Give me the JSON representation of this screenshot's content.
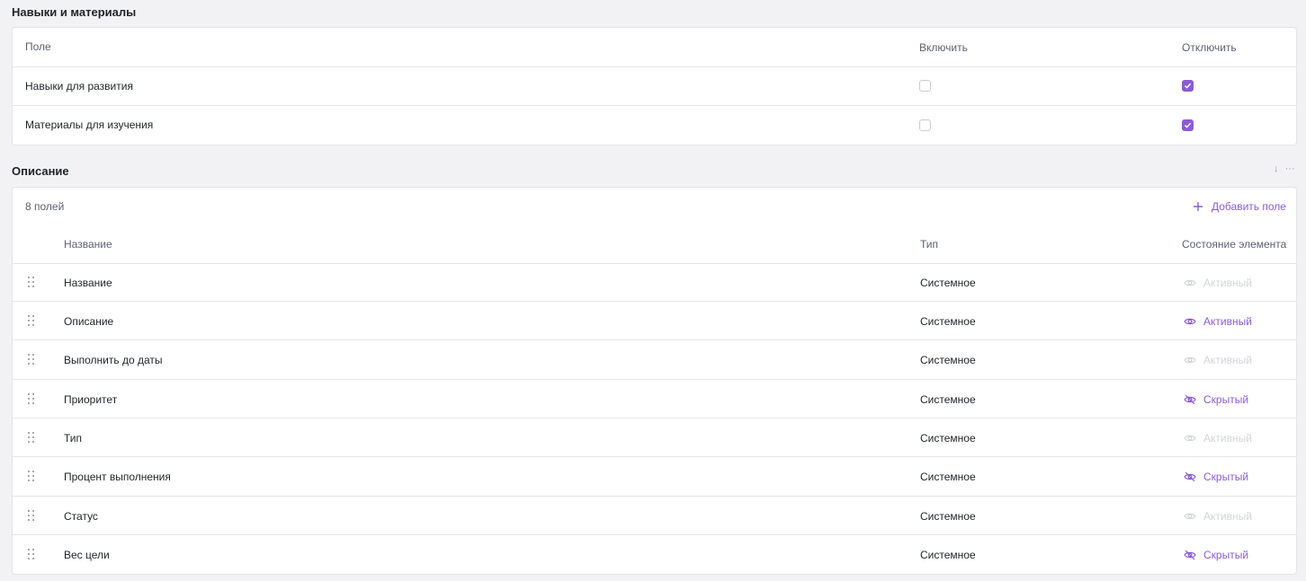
{
  "skills_section": {
    "title": "Навыки и материалы",
    "headers": {
      "field": "Поле",
      "enable": "Включить",
      "disable": "Отключить"
    },
    "rows": [
      {
        "label": "Навыки для развития",
        "enabled": false,
        "disabled": true
      },
      {
        "label": "Материалы для изучения",
        "enabled": false,
        "disabled": true
      }
    ]
  },
  "description_section": {
    "title": "Описание",
    "field_count": "8 полей",
    "add_field_label": "Добавить поле",
    "headers": {
      "name": "Название",
      "type": "Тип",
      "state": "Состояние элемента"
    },
    "rows": [
      {
        "name": "Название",
        "type": "Системное",
        "state": "Активный"
      },
      {
        "name": "Описание",
        "type": "Системное",
        "state": "Активный"
      },
      {
        "name": "Выполнить до даты",
        "type": "Системное",
        "state": "Активный"
      },
      {
        "name": "Приоритет",
        "type": "Системное",
        "state": "Скрытый"
      },
      {
        "name": "Тип",
        "type": "Системное",
        "state": "Активный"
      },
      {
        "name": "Процент выполнения",
        "type": "Системное",
        "state": "Скрытый"
      },
      {
        "name": "Статус",
        "type": "Системное",
        "state": "Активный"
      },
      {
        "name": "Вес цели",
        "type": "Системное",
        "state": "Скрытый"
      }
    ]
  },
  "icons": {
    "drag": "drag-handle-icon",
    "eye": "eye-icon",
    "eye_off": "eye-off-icon",
    "plus": "plus-icon",
    "check": "check-icon",
    "sort": "arrow-down-icon",
    "more": "more-icon"
  },
  "colors": {
    "accent": "#8b5cd6",
    "muted": "#d3d5da"
  }
}
